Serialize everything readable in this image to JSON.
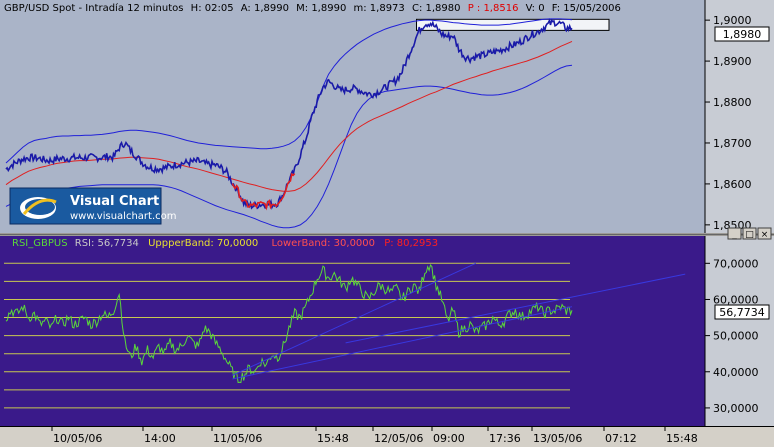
{
  "window": {
    "price_header": {
      "label": "GBP/USD Spot - Intradía 12 minutos",
      "H": "H: 02:05",
      "A": "A: 1,8990",
      "M": "M: 1,8990",
      "m": "m: 1,8973",
      "C": "C: 1,8980",
      "P": "P : 1,8516",
      "V": "V: 0",
      "F": "F: 15/05/2006"
    },
    "rsi_header": {
      "name": "RSI_GBPUS",
      "rsi": "RSI: 56,7734",
      "upper": "UppperBand: 70,0000",
      "lower": "LowerBand: 30,0000",
      "P": "P: 80,2953"
    },
    "logo": {
      "title": "Visual Chart",
      "url": "www.visualchart.com"
    },
    "current_price_tag": "1,8980",
    "current_rsi_tag": "56,7734",
    "time_axis": [
      "10/05/06",
      "14:00",
      "11/05/06",
      "15:48",
      "12/05/06",
      "09:00",
      "17:36",
      "13/05/06",
      "07:12",
      "15:48"
    ],
    "pane_buttons": [
      "_",
      "□",
      "×"
    ]
  },
  "colors": {
    "price_bg": "#aab4c8",
    "rsi_bg": "#3a1a8a",
    "price_line": "#1a1aa8",
    "red_line": "#e02020",
    "band_line": "#2020d8",
    "rsi_line": "#5ad83a",
    "rsi_grid": "#c8c850",
    "rsi_trend": "#3838e0"
  },
  "chart_data": [
    {
      "type": "line",
      "title": "GBP/USD Spot - Intradía 12 minutos",
      "ylim": [
        1.8485,
        1.9015
      ],
      "yticks": [
        "1,8500",
        "1,8600",
        "1,8700",
        "1,8800",
        "1,8900",
        "1,9000"
      ],
      "ytick_values": [
        1.85,
        1.86,
        1.87,
        1.88,
        1.89,
        1.9
      ],
      "x_steps": 100,
      "series": [
        {
          "role": "price",
          "values": [
            1.8636,
            1.8646,
            1.8654,
            1.8661,
            1.8664,
            1.8664,
            1.8662,
            1.8658,
            1.8657,
            1.8661,
            1.8662,
            1.8662,
            1.8664,
            1.8664,
            1.8664,
            1.8665,
            1.8664,
            1.8665,
            1.8667,
            1.8665,
            1.8688,
            1.8701,
            1.8682,
            1.8668,
            1.8653,
            1.8643,
            1.8638,
            1.8637,
            1.8639,
            1.8643,
            1.8647,
            1.865,
            1.8652,
            1.8654,
            1.8656,
            1.865,
            1.8647,
            1.8646,
            1.8639,
            1.8628,
            1.8603,
            1.8583,
            1.8554,
            1.8547,
            1.8547,
            1.855,
            1.855,
            1.855,
            1.8553,
            1.8575,
            1.8608,
            1.8633,
            1.8671,
            1.8711,
            1.8762,
            1.8802,
            1.8836,
            1.885,
            1.884,
            1.8829,
            1.883,
            1.8833,
            1.8832,
            1.8825,
            1.882,
            1.882,
            1.8827,
            1.8835,
            1.8845,
            1.8854,
            1.8875,
            1.891,
            1.8943,
            1.8975,
            1.8991,
            1.8993,
            1.8981,
            1.8966,
            1.896,
            1.8962,
            1.893,
            1.8911,
            1.8906,
            1.8911,
            1.8913,
            1.8917,
            1.8922,
            1.8925,
            1.893,
            1.8936,
            1.8941,
            1.8948,
            1.8957,
            1.8966,
            1.8972,
            1.8982,
            1.8991,
            1.8995,
            1.8991,
            1.898,
            1.898
          ]
        },
        {
          "role": "moving-average",
          "values": [
            1.8598,
            1.8608,
            1.8616,
            1.8624,
            1.8631,
            1.8636,
            1.864,
            1.8643,
            1.8647,
            1.865,
            1.8652,
            1.8654,
            1.8656,
            1.8657,
            1.8657,
            1.8658,
            1.8659,
            1.866,
            1.866,
            1.8661,
            1.8663,
            1.8664,
            1.8665,
            1.8665,
            1.8664,
            1.8663,
            1.8662,
            1.866,
            1.8657,
            1.8654,
            1.865,
            1.8646,
            1.8642,
            1.8639,
            1.8636,
            1.8632,
            1.8628,
            1.8624,
            1.862,
            1.8616,
            1.8612,
            1.8608,
            1.8604,
            1.86,
            1.8597,
            1.8593,
            1.8589,
            1.8586,
            1.8584,
            1.8582,
            1.8582,
            1.8584,
            1.859,
            1.86,
            1.8613,
            1.8628,
            1.8645,
            1.8663,
            1.8681,
            1.8697,
            1.8711,
            1.8724,
            1.8735,
            1.8744,
            1.8752,
            1.8759,
            1.8765,
            1.8771,
            1.8777,
            1.8783,
            1.8789,
            1.8796,
            1.8802,
            1.8808,
            1.8814,
            1.882,
            1.8825,
            1.8831,
            1.8837,
            1.8843,
            1.8848,
            1.8853,
            1.8858,
            1.8862,
            1.8867,
            1.8871,
            1.8876,
            1.888,
            1.8884,
            1.8888,
            1.8892,
            1.8896,
            1.89,
            1.8905,
            1.891,
            1.8916,
            1.8922,
            1.8929,
            1.8936,
            1.8942,
            1.8948
          ]
        },
        {
          "role": "upper-band",
          "values": [
            1.8651,
            1.8664,
            1.8677,
            1.869,
            1.87,
            1.8706,
            1.8709,
            1.8711,
            1.8714,
            1.8716,
            1.8717,
            1.8717,
            1.8718,
            1.8718,
            1.8719,
            1.8719,
            1.872,
            1.8721,
            1.8723,
            1.8725,
            1.8728,
            1.873,
            1.8731,
            1.8731,
            1.873,
            1.8728,
            1.8726,
            1.8724,
            1.8721,
            1.8718,
            1.8714,
            1.871,
            1.8706,
            1.8703,
            1.87,
            1.8698,
            1.8696,
            1.8694,
            1.8693,
            1.8692,
            1.8691,
            1.869,
            1.8689,
            1.8688,
            1.8687,
            1.8686,
            1.8686,
            1.8687,
            1.8689,
            1.8692,
            1.8697,
            1.8705,
            1.8718,
            1.8738,
            1.8765,
            1.88,
            1.8838,
            1.8868,
            1.8888,
            1.8904,
            1.8918,
            1.893,
            1.8941,
            1.895,
            1.8958,
            1.8966,
            1.8972,
            1.8978,
            1.8983,
            1.8987,
            1.8991,
            1.8994,
            1.8997,
            1.8999,
            1.9,
            1.9,
            1.8999,
            1.8998,
            1.8996,
            1.8994,
            1.8993,
            1.8991,
            1.899,
            1.8989,
            1.8988,
            1.8988,
            1.8988,
            1.8988,
            1.8989,
            1.899,
            1.8992,
            1.8994,
            1.8996,
            1.8998,
            1.9,
            1.9002,
            1.9003,
            1.9003,
            1.9003,
            1.9002,
            1.9001
          ]
        },
        {
          "role": "lower-band",
          "values": [
            1.8545,
            1.8552,
            1.8555,
            1.8558,
            1.8562,
            1.8566,
            1.8571,
            1.8576,
            1.858,
            1.8584,
            1.8587,
            1.859,
            1.8592,
            1.8594,
            1.8595,
            1.8596,
            1.8597,
            1.8598,
            1.8598,
            1.8598,
            1.8598,
            1.8598,
            1.8598,
            1.8598,
            1.8598,
            1.8598,
            1.8598,
            1.8597,
            1.8595,
            1.8592,
            1.8588,
            1.8583,
            1.8577,
            1.8571,
            1.8565,
            1.8559,
            1.8553,
            1.8547,
            1.8542,
            1.8537,
            1.8533,
            1.8529,
            1.8525,
            1.852,
            1.8515,
            1.8509,
            1.8504,
            1.8499,
            1.8495,
            1.8493,
            1.8493,
            1.8495,
            1.85,
            1.851,
            1.8525,
            1.8545,
            1.857,
            1.86,
            1.8635,
            1.8672,
            1.871,
            1.8745,
            1.8772,
            1.8792,
            1.8806,
            1.8816,
            1.8822,
            1.8826,
            1.8828,
            1.883,
            1.8832,
            1.8834,
            1.8836,
            1.8838,
            1.8839,
            1.8839,
            1.8838,
            1.8836,
            1.8834,
            1.8831,
            1.8828,
            1.8825,
            1.8822,
            1.882,
            1.8818,
            1.8817,
            1.8817,
            1.8818,
            1.882,
            1.8823,
            1.8827,
            1.8832,
            1.8838,
            1.8845,
            1.8852,
            1.886,
            1.8868,
            1.8876,
            1.8883,
            1.8888,
            1.889
          ]
        }
      ],
      "red_segment": [
        40,
        51
      ],
      "highlight_box": {
        "y0": 1.8975,
        "y1": 1.9002,
        "x0": 72,
        "x1": 100
      }
    },
    {
      "type": "line",
      "title": "RSI_GBPUS",
      "ylim": [
        25,
        77
      ],
      "yticks": [
        "30,0000",
        "40,0000",
        "50,0000",
        "60,0000",
        "70,0000"
      ],
      "ytick_values": [
        30,
        40,
        50,
        60,
        70
      ],
      "grid": [
        30,
        35,
        40,
        45,
        50,
        55,
        60,
        65,
        70
      ],
      "series": [
        {
          "role": "rsi",
          "values": [
            55,
            57,
            56,
            58,
            55,
            56,
            53,
            54,
            52,
            55,
            53,
            55,
            53,
            54,
            55,
            53,
            54,
            56,
            55,
            57,
            62,
            48,
            44,
            47,
            43,
            46,
            44,
            47,
            45,
            48,
            46,
            47,
            50,
            48,
            47,
            52,
            51,
            48,
            46,
            43,
            40,
            38,
            39,
            41,
            40,
            43,
            42,
            45,
            44,
            47,
            52,
            56,
            55,
            58,
            62,
            66,
            68,
            66,
            67,
            65,
            63,
            66,
            64,
            62,
            60,
            62,
            64,
            63,
            62,
            63,
            60,
            62,
            64,
            62,
            68,
            70,
            64,
            60,
            54,
            57,
            51,
            52,
            53,
            51,
            52,
            53,
            55,
            53,
            54,
            56,
            57,
            55,
            56,
            57,
            58,
            56,
            57,
            57,
            58,
            57,
            57
          ]
        },
        {
          "role": "trend-1",
          "points": [
            [
              40,
              39
            ],
            [
              83,
              70
            ]
          ]
        },
        {
          "role": "trend-2",
          "points": [
            [
              40,
              38
            ],
            [
              100,
              58
            ]
          ]
        },
        {
          "role": "trend-3",
          "points": [
            [
              60,
              48
            ],
            [
              120,
              67
            ]
          ]
        }
      ]
    }
  ]
}
